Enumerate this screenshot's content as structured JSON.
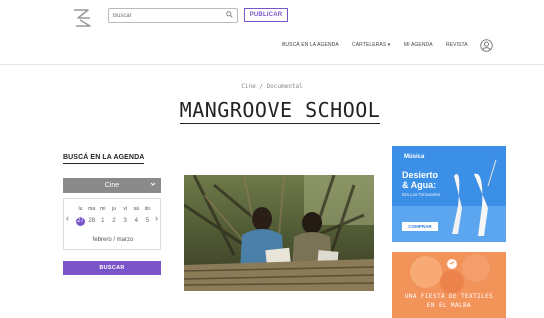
{
  "header": {
    "search": {
      "placeholder": "Buscar"
    },
    "publish_label": "PUBLICAR"
  },
  "nav": {
    "items": [
      {
        "label": "BUSCÁ EN LA AGENDA"
      },
      {
        "label": "CARTELERAS ▾"
      },
      {
        "label": "MI AGENDA"
      },
      {
        "label": "REVISTA"
      }
    ]
  },
  "breadcrumb": "Cine / Documental",
  "page_title": "MANGROOVE SCHOOL",
  "sidebar": {
    "title": "BUSCÁ EN LA AGENDA",
    "category": "Cine",
    "day_names": [
      "lu",
      "ma",
      "mi",
      "ju",
      "vi",
      "sá",
      "do"
    ],
    "days": [
      "27",
      "28",
      "1",
      "2",
      "3",
      "4",
      "5"
    ],
    "selected_day": "27",
    "months_label": "febrero / marzo",
    "search_label": "BUSCAR"
  },
  "ads": {
    "music": {
      "category": "Música",
      "line1": "Desierto",
      "line2": "& Agua:",
      "subtitle": "Dia Los Tornasoles",
      "button": "COMPRAR"
    },
    "textiles": {
      "line1": "UNA FIESTA DE TEXTILES",
      "line2": "EN EL MALBA"
    }
  },
  "colors": {
    "accent": "#7a55c9",
    "select_bg": "#8a8a8a",
    "ad_music_bg": "#3c8fe6",
    "ad_textiles_bg": "#f2935a"
  }
}
